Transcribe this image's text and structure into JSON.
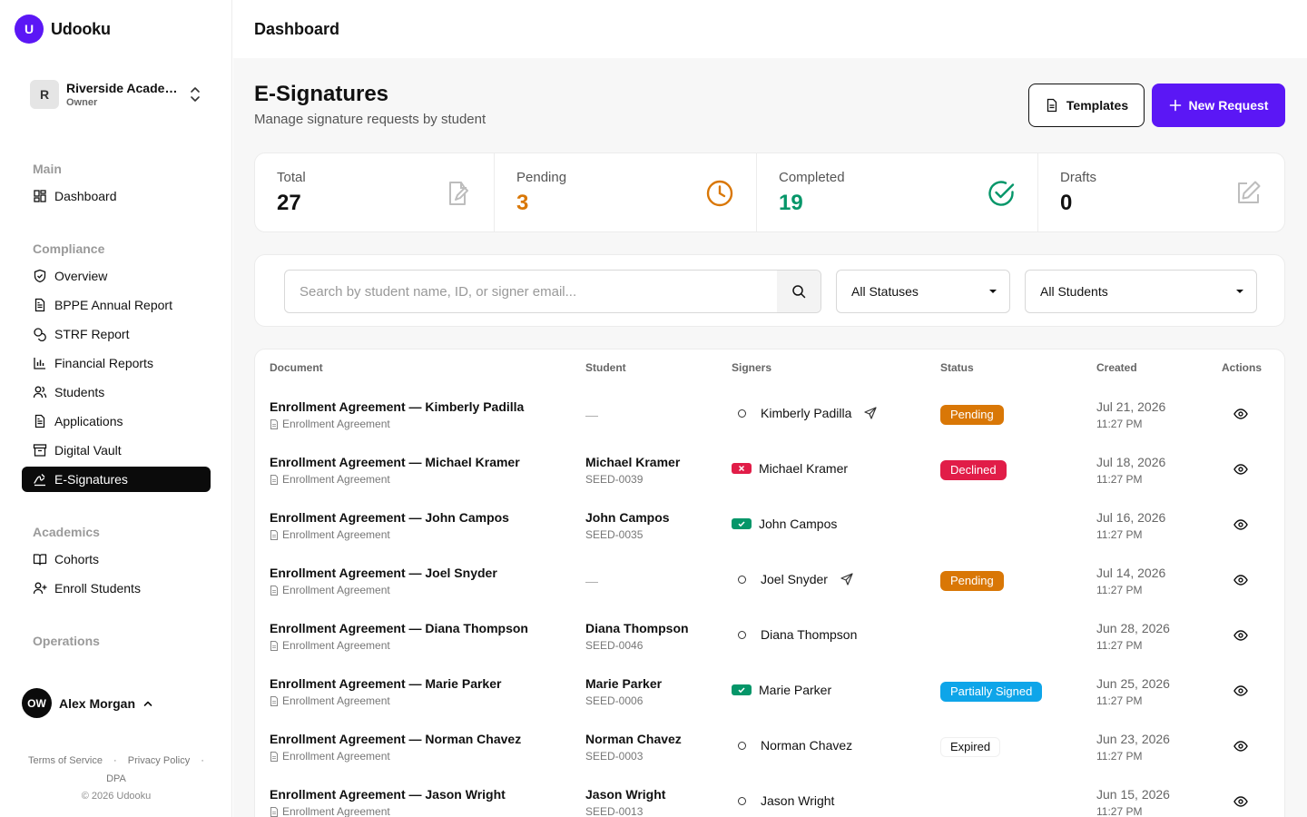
{
  "app": {
    "logo_letter": "U",
    "name": "Udooku"
  },
  "org": {
    "initial": "R",
    "name": "Riverside Academy of Arts",
    "role": "Owner"
  },
  "nav": {
    "main_label": "Main",
    "main_items": [
      {
        "label": "Dashboard",
        "icon": "grid-icon"
      }
    ],
    "compliance_label": "Compliance",
    "compliance_items": [
      {
        "label": "Overview",
        "icon": "shield-icon"
      },
      {
        "label": "BPPE Annual Report",
        "icon": "file-text-icon"
      },
      {
        "label": "STRF Report",
        "icon": "coins-icon"
      },
      {
        "label": "Financial Reports",
        "icon": "bar-chart-icon"
      },
      {
        "label": "Students",
        "icon": "users-icon"
      },
      {
        "label": "Applications",
        "icon": "file-text-icon"
      },
      {
        "label": "Digital Vault",
        "icon": "archive-icon"
      },
      {
        "label": "E-Signatures",
        "icon": "signature-icon",
        "active": true
      }
    ],
    "academics_label": "Academics",
    "academics_items": [
      {
        "label": "Cohorts",
        "icon": "book-open-icon"
      },
      {
        "label": "Enroll Students",
        "icon": "user-plus-icon"
      }
    ],
    "operations_label": "Operations"
  },
  "user": {
    "initials": "OW",
    "name": "Alex Morgan"
  },
  "footer": {
    "terms": "Terms of Service",
    "privacy": "Privacy Policy",
    "dpa": "DPA",
    "copyright": "© 2026 Udooku"
  },
  "topbar": {
    "title": "Dashboard"
  },
  "page": {
    "title": "E-Signatures",
    "subtitle": "Manage signature requests by student",
    "templates_button": "Templates",
    "new_request_button": "New Request"
  },
  "stats": [
    {
      "label": "Total",
      "value": "27",
      "color": "#111111",
      "icon": "file-signature-icon"
    },
    {
      "label": "Pending",
      "value": "3",
      "color": "#d97706",
      "icon": "clock-icon"
    },
    {
      "label": "Completed",
      "value": "19",
      "color": "#059669",
      "icon": "check-circle-icon"
    },
    {
      "label": "Drafts",
      "value": "0",
      "color": "#111111",
      "icon": "edit-icon"
    }
  ],
  "filters": {
    "search_placeholder": "Search by student name, ID, or signer email...",
    "status_select": "All Statuses",
    "student_select": "All Students"
  },
  "table": {
    "headers": {
      "document": "Document",
      "student": "Student",
      "signers": "Signers",
      "status": "Status",
      "created": "Created",
      "actions": "Actions"
    },
    "rows": [
      {
        "doc_title": "Enrollment Agreement — Kimberly Padilla",
        "doc_type": "Enrollment Agreement",
        "student_name": "—",
        "student_id": "",
        "signer": "Kimberly Padilla",
        "signer_state": "pending",
        "sent": true,
        "status": "Pending",
        "status_kind": "pending",
        "date": "Jul 21, 2026",
        "time": "11:27 PM"
      },
      {
        "doc_title": "Enrollment Agreement — Michael Kramer",
        "doc_type": "Enrollment Agreement",
        "student_name": "Michael Kramer",
        "student_id": "SEED-0039",
        "signer": "Michael Kramer",
        "signer_state": "declined",
        "sent": false,
        "status": "Declined",
        "status_kind": "declined",
        "date": "Jul 18, 2026",
        "time": "11:27 PM"
      },
      {
        "doc_title": "Enrollment Agreement — John Campos",
        "doc_type": "Enrollment Agreement",
        "student_name": "John Campos",
        "student_id": "SEED-0035",
        "signer": "John Campos",
        "signer_state": "signed",
        "sent": false,
        "status": "",
        "status_kind": "none",
        "date": "Jul 16, 2026",
        "time": "11:27 PM"
      },
      {
        "doc_title": "Enrollment Agreement — Joel Snyder",
        "doc_type": "Enrollment Agreement",
        "student_name": "—",
        "student_id": "",
        "signer": "Joel Snyder",
        "signer_state": "pending",
        "sent": true,
        "status": "Pending",
        "status_kind": "pending",
        "date": "Jul 14, 2026",
        "time": "11:27 PM"
      },
      {
        "doc_title": "Enrollment Agreement — Diana Thompson",
        "doc_type": "Enrollment Agreement",
        "student_name": "Diana Thompson",
        "student_id": "SEED-0046",
        "signer": "Diana Thompson",
        "signer_state": "pending",
        "sent": false,
        "status": "",
        "status_kind": "none",
        "date": "Jun 28, 2026",
        "time": "11:27 PM"
      },
      {
        "doc_title": "Enrollment Agreement — Marie Parker",
        "doc_type": "Enrollment Agreement",
        "student_name": "Marie Parker",
        "student_id": "SEED-0006",
        "signer": "Marie Parker",
        "signer_state": "signed",
        "sent": false,
        "status": "Partially Signed",
        "status_kind": "partial",
        "date": "Jun 25, 2026",
        "time": "11:27 PM"
      },
      {
        "doc_title": "Enrollment Agreement — Norman Chavez",
        "doc_type": "Enrollment Agreement",
        "student_name": "Norman Chavez",
        "student_id": "SEED-0003",
        "signer": "Norman Chavez",
        "signer_state": "pending",
        "sent": false,
        "status": "Expired",
        "status_kind": "expired",
        "date": "Jun 23, 2026",
        "time": "11:27 PM"
      },
      {
        "doc_title": "Enrollment Agreement — Jason Wright",
        "doc_type": "Enrollment Agreement",
        "student_name": "Jason Wright",
        "student_id": "SEED-0013",
        "signer": "Jason Wright",
        "signer_state": "pending",
        "sent": false,
        "status": "",
        "status_kind": "none",
        "date": "Jun 15, 2026",
        "time": "11:27 PM"
      }
    ]
  },
  "colors": {
    "brand": "#5b17f5",
    "pending": "#d97706",
    "declined": "#e11d48",
    "signed": "#059669",
    "partial": "#0ea5e9"
  }
}
